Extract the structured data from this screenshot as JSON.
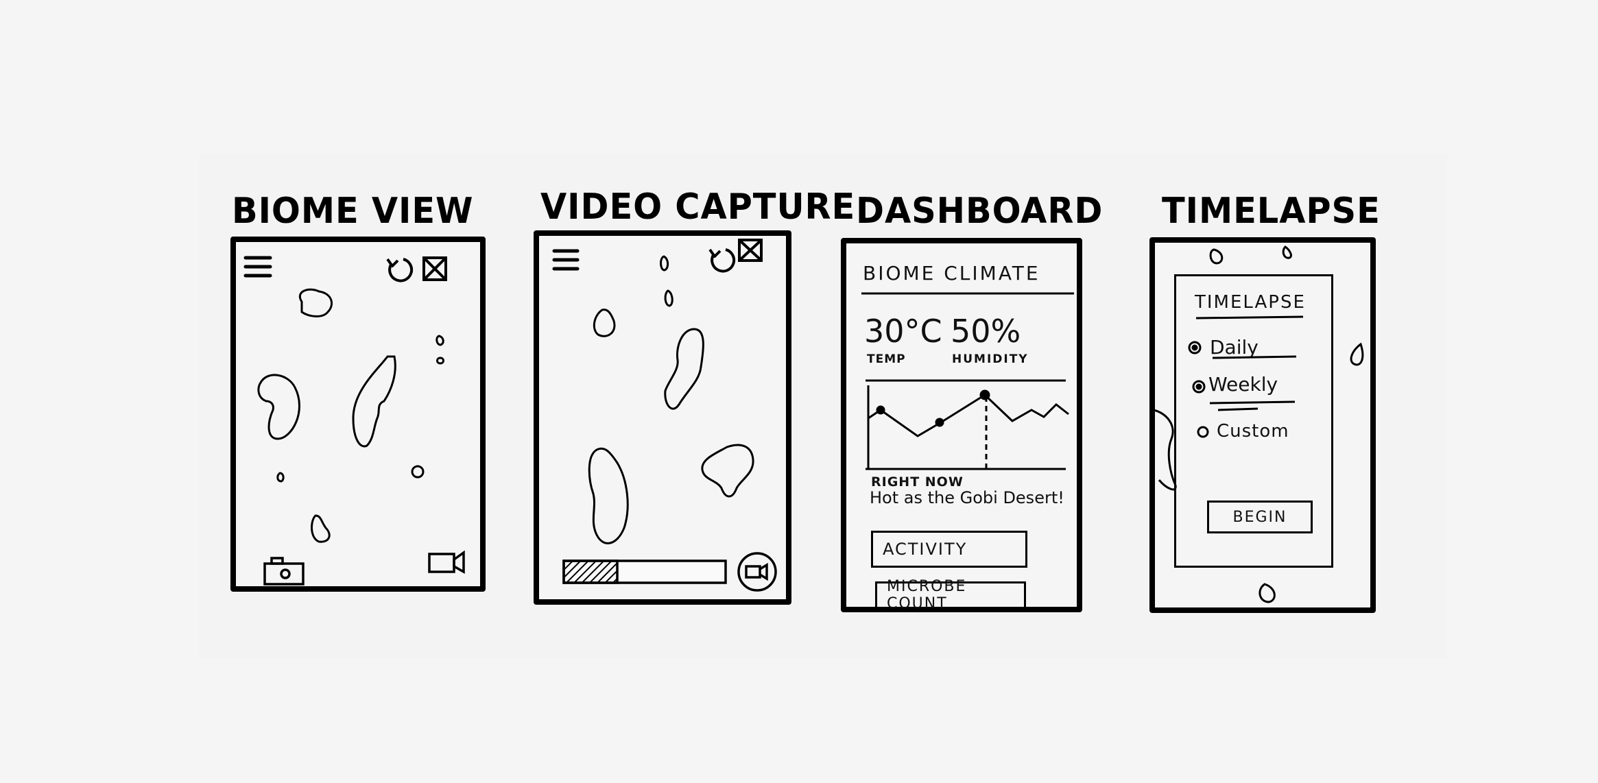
{
  "screens": {
    "biome_view": {
      "title": "BIOME VIEW"
    },
    "video_capture": {
      "title": "VIDEO CAPTURE",
      "progress": 0.33
    },
    "dashboard": {
      "title": "DASHBOARD",
      "header": "BIOME CLIMATE",
      "temp_value": "30°C",
      "temp_label": "TEMP",
      "humidity_value": "50%",
      "humidity_label": "HUMIDITY",
      "right_now_label": "RIGHT NOW",
      "right_now_text": "Hot as the Gobi Desert!",
      "buttons": [
        "ACTIVITY",
        "MICROBE COUNT"
      ]
    },
    "timelapse": {
      "title": "TIMELAPSE",
      "panel_title": "TIMELAPSE",
      "options": [
        "Daily",
        "Weekly",
        "Custom"
      ],
      "begin_label": "BEGIN"
    }
  },
  "icons": [
    "menu-icon",
    "refresh-icon",
    "close-box-icon",
    "camera-icon",
    "video-camera-icon"
  ]
}
